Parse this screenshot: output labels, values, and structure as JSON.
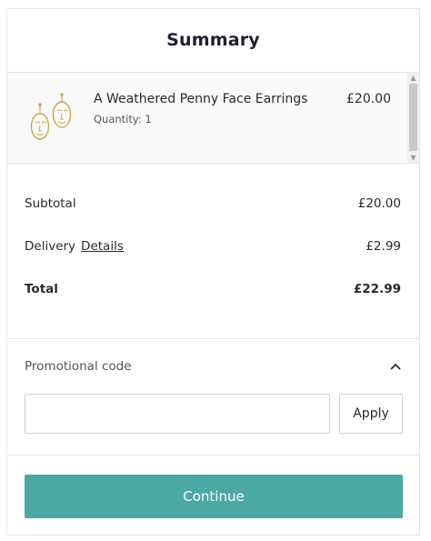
{
  "summary": {
    "title": "Summary"
  },
  "cart_item": {
    "name": "A Weathered Penny Face Earrings",
    "quantity_text": "Quantity: 1",
    "price": "£20.00",
    "image_icon": "face-earrings-thumbnail"
  },
  "totals": {
    "subtotal_label": "Subtotal",
    "subtotal_value": "£20.00",
    "delivery_label": "Delivery",
    "delivery_details_link": "Details",
    "delivery_value": "£2.99",
    "total_label": "Total",
    "total_value": "£22.99"
  },
  "promo": {
    "label": "Promotional code",
    "input_value": "",
    "input_placeholder": "",
    "apply_label": "Apply",
    "toggle_icon": "chevron-up-icon"
  },
  "actions": {
    "continue_label": "Continue"
  },
  "colors": {
    "accent": "#4aa9a4",
    "border": "#e4e4e4",
    "item_bg": "#fafafa"
  }
}
